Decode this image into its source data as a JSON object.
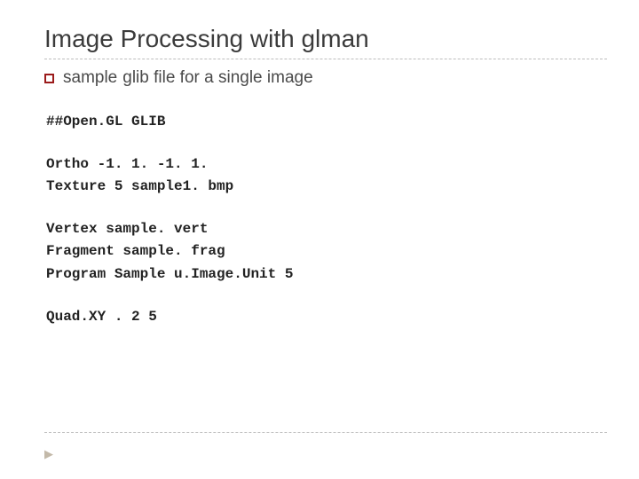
{
  "title": "Image Processing with glman",
  "subtitle_lead": "sample",
  "subtitle_rest": "glib file for a single image",
  "code": {
    "block1": "##Open.GL GLIB",
    "block2": "Ortho -1. 1. -1. 1.\nTexture 5 sample1. bmp",
    "block3": "Vertex sample. vert\nFragment sample. frag\nProgram Sample u.Image.Unit 5",
    "block4": "Quad.XY . 2 5"
  }
}
